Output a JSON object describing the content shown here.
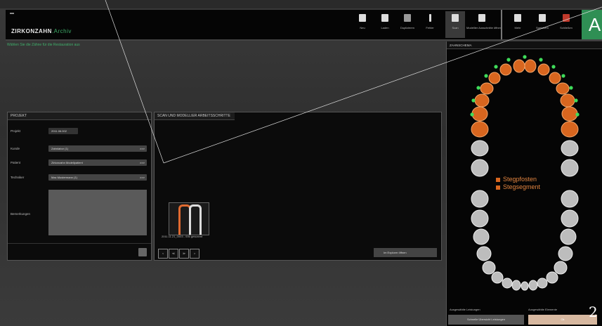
{
  "titlebar": {
    "window_label": "▬",
    "logo_main": "ZIRKONZAHN",
    "logo_sub": ".Archiv",
    "toolbar": [
      {
        "label": "Neu",
        "icon": "new-file-icon"
      },
      {
        "label": "Laden",
        "icon": "folder-icon"
      },
      {
        "label": "Duplizieren",
        "icon": "duplicate-icon"
      },
      {
        "label": "Fehler",
        "icon": "warning-icon"
      },
      {
        "label": "Scan",
        "icon": "scan-icon"
      },
      {
        "label": "Modellier Ausschnitte öffnen",
        "icon": "model-icon"
      },
      {
        "label": "Mehr",
        "icon": "monitor-icon"
      },
      {
        "label": "Speichern",
        "icon": "save-icon"
      },
      {
        "label": "Schließen",
        "icon": "close-icon"
      }
    ],
    "app_badge": "A"
  },
  "hint": "Wählen Sie die Zähne für die Restauration aus",
  "project_panel": {
    "title": "PROJEKT",
    "fields": [
      {
        "label": "Projekt",
        "value": "2011.06.002"
      },
      {
        "label": "Kunde",
        "value": "Zahnlabor (1)",
        "has_arrow": true
      },
      {
        "label": "Patient",
        "value": "Zirkonzahn Modellpatient",
        "has_arrow": true
      },
      {
        "label": "Techniker",
        "value": "Max Mustermann (1)",
        "has_arrow": true
      }
    ],
    "notes_label": "Bemerkungen",
    "arrow": ">>>"
  },
  "scan_panel": {
    "title": "SCAN UND MODELLIER ARBEITSSCHRITTE",
    "thumb_caption": "2011.11.21_0003 - 006 gescannt",
    "nav": [
      "<",
      "≪",
      "≫",
      ">"
    ],
    "open_button": "Im Explorer öffnen"
  },
  "tooth_panel": {
    "title": "ZAHNSCHEMA",
    "legend": [
      "Stegpfosten",
      "Stegsegment"
    ],
    "bottom_left_label": "Ausgewählte Leistungen",
    "bottom_right_label": "Ausgewählte Elemente",
    "bottom_left_button": "Schnelle Übersicht Leistungen",
    "bottom_right_button": "Ok"
  },
  "page_number": "2",
  "colors": {
    "accent": "#3fae6a",
    "selected_tooth": "#d8661f",
    "badge": "#2f8f54"
  }
}
